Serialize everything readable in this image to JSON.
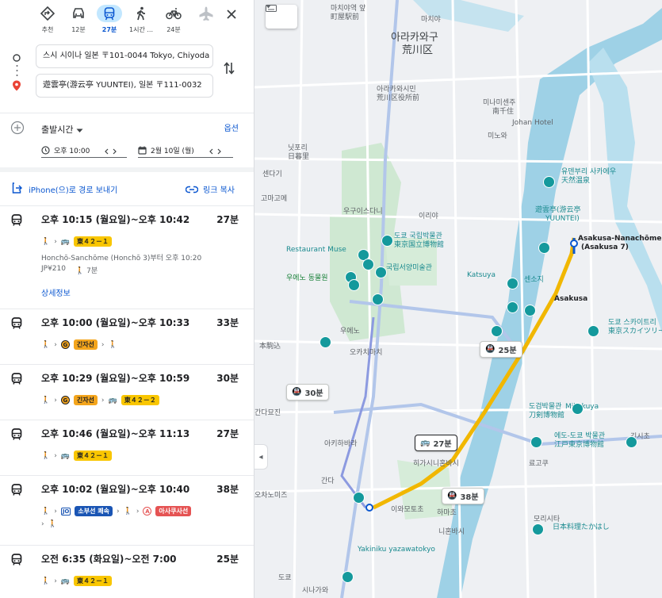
{
  "modes": [
    {
      "label": "추천",
      "icon": "diamond-route-icon"
    },
    {
      "label": "12분",
      "icon": "car-icon"
    },
    {
      "label": "27분",
      "icon": "transit-icon"
    },
    {
      "label": "1시간 ...",
      "icon": "walk-icon"
    },
    {
      "label": "24분",
      "icon": "bike-icon"
    },
    {
      "label": "",
      "icon": "flight-icon"
    }
  ],
  "origin": "스시 시이나 일본 〒101-0044 Tokyo, Chiyoda",
  "destination": "遊雲亭(游云亭 YUUNTEI), 일본 〒111-0032",
  "depart": {
    "label": "출발시간",
    "options_label": "옵션",
    "time": "오후 10:00",
    "date": "2월 10일 (월)"
  },
  "share": {
    "send_label": "iPhone(으)로 경로 보내기",
    "copy_label": "링크 복사"
  },
  "routes": [
    {
      "time": "오후 10:15 (월요일)~오후 10:42",
      "duration": "27분",
      "line": "東４２－１",
      "detail": "Honchō-Sanchōme (Honchō 3)부터 오후 10:20",
      "fare": "JP¥210",
      "walk": "7분",
      "details_link": "상세정보"
    },
    {
      "time": "오후 10:00 (월요일)~오후 10:33",
      "duration": "33분",
      "line": "긴자선"
    },
    {
      "time": "오후 10:29 (월요일)~오후 10:59",
      "duration": "30분",
      "line": "긴자선",
      "line2": "東４２－２"
    },
    {
      "time": "오후 10:46 (월요일)~오후 11:13",
      "duration": "27분",
      "line": "東４２－１"
    },
    {
      "time": "오후 10:02 (월요일)~오후 10:40",
      "duration": "38분",
      "line": "소부선 쾌속",
      "line2": "아사쿠사선"
    },
    {
      "time": "오전 6:35 (화요일)~오전 7:00",
      "duration": "25분",
      "line": "東４２－１"
    }
  ],
  "map": {
    "labels": {
      "l1": "마치야역 앞",
      "l2": "町屋駅前",
      "l3": "마치야",
      "l4": "아라카와구",
      "l5": "荒川区",
      "l6": "아라카와시민",
      "l7": "荒川区役所前",
      "l8": "미나미센주",
      "l9": "南千住",
      "l10": "닛포리",
      "l11": "日暮里",
      "l12": "센다기",
      "l13": "우구이스다니",
      "l14": "이리야",
      "l15": "유덴부리 사카에우",
      "l16": "天然温泉",
      "l17": "遊雲亭(游云亭",
      "l18": "YUUNTEI)",
      "l19": "Asakusa-Nanachōme",
      "l20": "(Asakusa 7)",
      "l21": "Restaurant Muse",
      "l22": "도쿄 국립박물관",
      "l23": "東京国立博物館",
      "l24": "국립서양미술관",
      "l25": "Katsuya",
      "l26": "센소지",
      "l27": "Asakusa",
      "l28": "도쿄 스카이트리",
      "l29": "東京スカイツリー",
      "l30": "우에노 동물원",
      "l31": "오카치마치",
      "l32": "Mikokuya",
      "l33": "도검박물관",
      "l34": "刀剣博物館",
      "l35": "에도-도쿄 박물관",
      "l36": "江戸東京博物館",
      "l37": "긴시초",
      "l38": "히가시니혼바시",
      "l39": "간다",
      "l40": "니혼바시",
      "l41": "日本料理たかはし",
      "l42": "Yakiniku yazawatokyo",
      "l43": "간다묘진",
      "l44": "아키하바라",
      "l45": "모리시타",
      "l46": "료고쿠",
      "l47": "오차노미즈",
      "l48": "Johan Hotel",
      "l49": "이와모토초",
      "l50": "하마초",
      "l51": "미노와",
      "l52": "우에노",
      "l53": "本駒込",
      "l54": "고마고메",
      "l55": "도쿄",
      "l56": "시나가와"
    },
    "route_boxes": [
      "25분",
      "30분",
      "27분",
      "38분"
    ]
  }
}
